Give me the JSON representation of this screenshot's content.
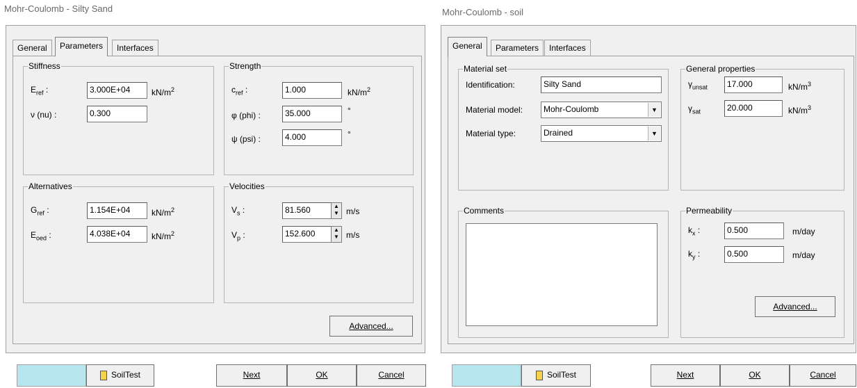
{
  "left": {
    "window_title": "Mohr-Coulomb - Silty Sand",
    "tabs": [
      {
        "label": "General"
      },
      {
        "label": "Parameters"
      },
      {
        "label": "Interfaces"
      }
    ],
    "stiffness": {
      "title": "Stiffness",
      "E_ref": {
        "symbol": "E",
        "sub": "ref",
        "suffix": ":",
        "value": "3.000E+04",
        "unit": "kN/m",
        "unit_sup": "2"
      },
      "nu": {
        "label": "ν (nu) :",
        "value": "0.300"
      }
    },
    "strength": {
      "title": "Strength",
      "c_ref": {
        "symbol": "c",
        "sub": "ref",
        "suffix": ":",
        "value": "1.000",
        "unit": "kN/m",
        "unit_sup": "2"
      },
      "phi": {
        "label": "φ (phi) :",
        "value": "35.000",
        "unit": "°"
      },
      "psi": {
        "label": "ψ (psi) :",
        "value": "4.000",
        "unit": "°"
      }
    },
    "alternatives": {
      "title": "Alternatives",
      "G_ref": {
        "symbol": "G",
        "sub": "ref",
        "suffix": ":",
        "value": "1.154E+04",
        "unit": "kN/m",
        "unit_sup": "2"
      },
      "E_oed": {
        "symbol": "E",
        "sub": "oed",
        "suffix": ":",
        "value": "4.038E+04",
        "unit": "kN/m",
        "unit_sup": "2"
      }
    },
    "velocities": {
      "title": "Velocities",
      "Vs": {
        "symbol": "V",
        "sub": "s",
        "suffix": ":",
        "value": "81.560",
        "unit": "m/s"
      },
      "Vp": {
        "symbol": "V",
        "sub": "p",
        "suffix": ":",
        "value": "152.600",
        "unit": "m/s"
      }
    },
    "advanced_label": "Advanced...",
    "bottom": {
      "soiltest": "SoilTest",
      "next": "Next",
      "ok": "OK",
      "cancel": "Cancel"
    }
  },
  "right": {
    "window_title": "Mohr-Coulomb - soil",
    "tabs": [
      {
        "label": "General"
      },
      {
        "label": "Parameters"
      },
      {
        "label": "Interfaces"
      }
    ],
    "material_set": {
      "title": "Material set",
      "identification": {
        "label": "Identification:",
        "value": "Silty Sand"
      },
      "model": {
        "label": "Material model:",
        "value": "Mohr-Coulomb"
      },
      "type": {
        "label": "Material type:",
        "value": "Drained"
      }
    },
    "general_properties": {
      "title": "General properties",
      "g_unsat": {
        "symbol": "γ",
        "sub": "unsat",
        "value": "17.000",
        "unit": "kN/m",
        "unit_sup": "3"
      },
      "g_sat": {
        "symbol": "γ",
        "sub": "sat",
        "value": "20.000",
        "unit": "kN/m",
        "unit_sup": "3"
      }
    },
    "comments": {
      "title": "Comments"
    },
    "permeability": {
      "title": "Permeability",
      "kx": {
        "symbol": "k",
        "sub": "x",
        "suffix": ":",
        "value": "0.500",
        "unit": "m/day"
      },
      "ky": {
        "symbol": "k",
        "sub": "y",
        "suffix": ":",
        "value": "0.500",
        "unit": "m/day"
      }
    },
    "advanced_label": "Advanced...",
    "bottom": {
      "soiltest": "SoilTest",
      "next": "Next",
      "ok": "OK",
      "cancel": "Cancel"
    }
  },
  "colors": {
    "dialog_bg": "#f0f0f0",
    "cyan_button": "#b7e6ee",
    "title_text": "#6a6a6a"
  },
  "icons": {
    "soiltest": "soiltest-document-icon",
    "dropdown": "dropdown-arrow-icon",
    "spinner": "spinner-updown-icon"
  }
}
